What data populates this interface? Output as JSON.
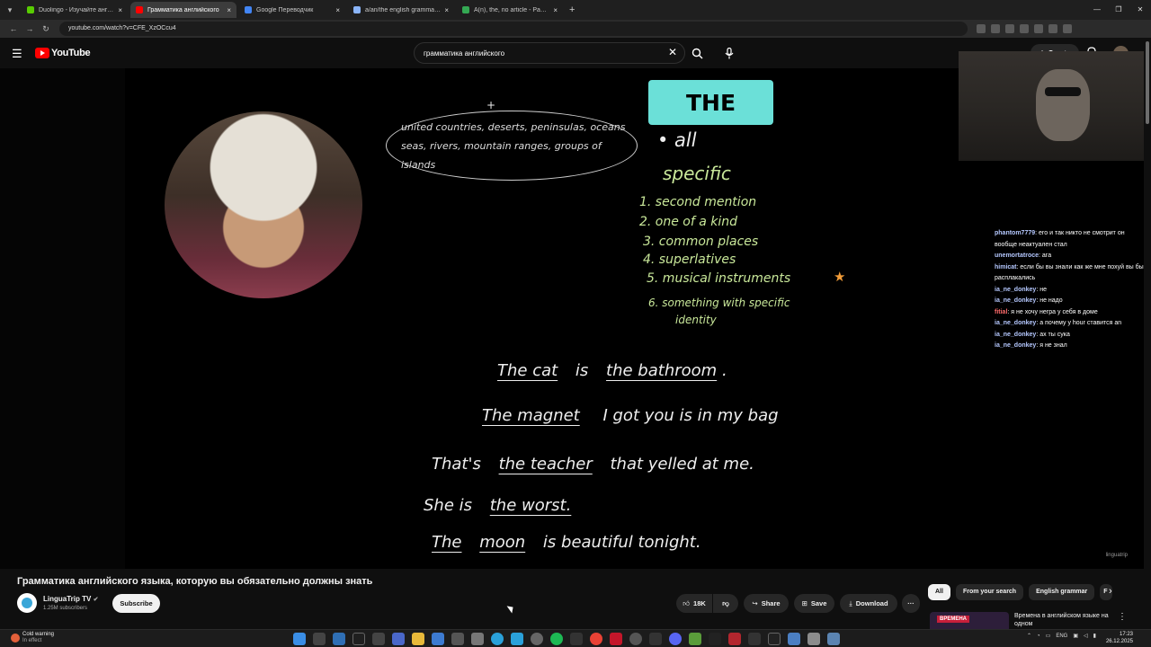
{
  "browser": {
    "tabs": [
      {
        "title": "Duolingo - Изучайте английск",
        "color": "#58cc02",
        "active": false
      },
      {
        "title": "Грамматика английского",
        "color": "#ff0000",
        "active": true
      },
      {
        "title": "Google Переводчик",
        "color": "#4285f4",
        "active": false
      },
      {
        "title": "a/an/the english grammar gam",
        "color": "#8ab4f8",
        "active": false
      },
      {
        "title": "A(n), the, no article - Page 3 of",
        "color": "#34a853",
        "active": false
      }
    ],
    "url": "youtube.com/watch?v=CFE_XzOCcu4"
  },
  "header": {
    "logo_text": "YouTube",
    "search_value": "грамматика английского",
    "create_label": "Create"
  },
  "video": {
    "the_label": "THE",
    "ellipse_text": "united countries, deserts, peninsulas, oceans seas, rivers, mountain ranges, groups of islands",
    "plus": "+",
    "bullet_all": "• all",
    "specific": "specific",
    "rules": [
      "1. second mention",
      "2. one of a kind",
      "3. common places",
      "4. superlatives",
      "5. musical instruments",
      "6. something with specific",
      "identity"
    ],
    "star": "★",
    "sentences": {
      "s1_a": "The cat",
      "s1_b": "is",
      "s1_c": "the bathroom",
      "s1_d": ".",
      "s2_a": "The magnet",
      "s2_b": "I got you  is in my bag",
      "s3_a": "That's",
      "s3_b": "the teacher",
      "s3_c": "that yelled at me.",
      "s4_a": "She is",
      "s4_b": "the worst.",
      "s5_a": "The",
      "s5_b": "moon",
      "s5_c": "is beautiful tonight."
    },
    "watermark": "linguatrip"
  },
  "chat": [
    {
      "user": "phantom7779",
      "msg": "его и так никто не смотрит он вообще неактуален стал",
      "red": false
    },
    {
      "user": "unemortatroce",
      "msg": "ага",
      "red": false
    },
    {
      "user": "himicat",
      "msg": "если бы вы знали как же мне похуй вы бы расплакались",
      "red": false
    },
    {
      "user": "ia_ne_donkey",
      "msg": "не",
      "red": false
    },
    {
      "user": "ia_ne_donkey",
      "msg": "не надо",
      "red": false
    },
    {
      "user": "fitial",
      "msg": "я не хочу негра у себя в доме",
      "red": true
    },
    {
      "user": "ia_ne_donkey",
      "msg": "а почему у hour ставится an",
      "red": false
    },
    {
      "user": "ia_ne_donkey",
      "msg": "ах ты сука",
      "red": false
    },
    {
      "user": "ia_ne_donkey",
      "msg": "я не знал",
      "red": false
    }
  ],
  "below": {
    "title": "Грамматика английского языка, которую вы обязательно должны знать",
    "channel_name": "LinguaTrip TV",
    "verified": "✔",
    "subscribers": "1.25M subscribers",
    "subscribe_label": "Subscribe",
    "likes": "18K",
    "share_label": "Share",
    "save_label": "Save",
    "download_label": "Download",
    "more": "···",
    "chips": [
      "All",
      "From your search",
      "English grammar",
      "F"
    ],
    "rec_badge": "ВРЕМЕНА",
    "rec_title": "Времена в английском языке на одном"
  },
  "taskbar": {
    "weather_title": "Cold warning",
    "weather_sub": "In effect",
    "lang": "ENG",
    "time": "17:23",
    "date": "26.12.2025"
  }
}
